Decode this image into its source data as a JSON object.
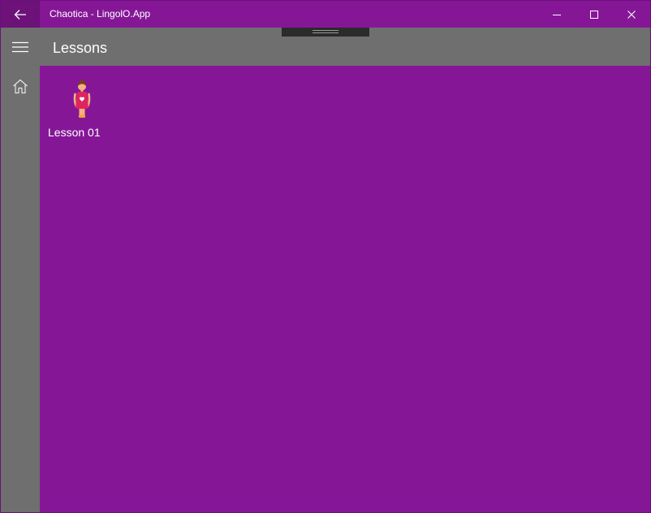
{
  "window": {
    "title": "Chaotica - LingolO.App"
  },
  "header": {
    "title": "Lessons"
  },
  "lessons": [
    {
      "label": "Lesson 01",
      "icon": "woman-figure-icon"
    }
  ],
  "colors": {
    "accent": "#851797",
    "back_button_bg": "#6c1279",
    "chrome_gray": "#6f6f6f",
    "drag_handle": "#2b2b2b",
    "text": "#ffffff"
  }
}
